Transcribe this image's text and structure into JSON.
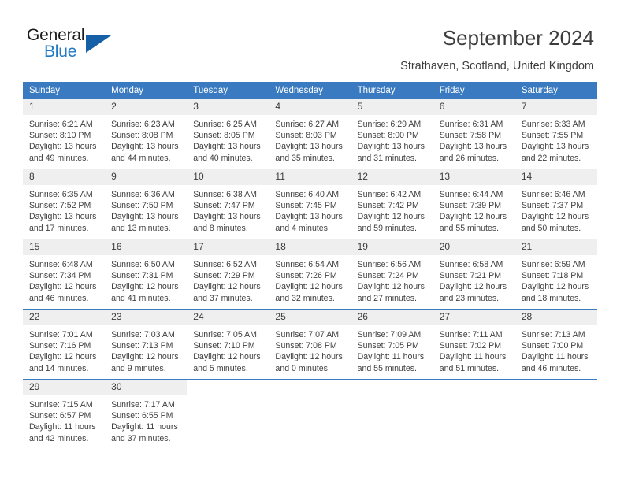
{
  "brand": {
    "name_top": "General",
    "name_bottom": "Blue",
    "triangle_color": "#1660a8",
    "blue_color": "#1f7ac4"
  },
  "header": {
    "title": "September 2024",
    "subtitle": "Strathaven, Scotland, United Kingdom"
  },
  "theme": {
    "header_blue": "#3a7ac0",
    "daynum_band": "#efefef",
    "text": "#3a3a3a"
  },
  "calendar": {
    "weekday_headers": [
      "Sunday",
      "Monday",
      "Tuesday",
      "Wednesday",
      "Thursday",
      "Friday",
      "Saturday"
    ],
    "weeks": [
      [
        {
          "day": "1",
          "sunrise": "Sunrise: 6:21 AM",
          "sunset": "Sunset: 8:10 PM",
          "daylight1": "Daylight: 13 hours",
          "daylight2": "and 49 minutes."
        },
        {
          "day": "2",
          "sunrise": "Sunrise: 6:23 AM",
          "sunset": "Sunset: 8:08 PM",
          "daylight1": "Daylight: 13 hours",
          "daylight2": "and 44 minutes."
        },
        {
          "day": "3",
          "sunrise": "Sunrise: 6:25 AM",
          "sunset": "Sunset: 8:05 PM",
          "daylight1": "Daylight: 13 hours",
          "daylight2": "and 40 minutes."
        },
        {
          "day": "4",
          "sunrise": "Sunrise: 6:27 AM",
          "sunset": "Sunset: 8:03 PM",
          "daylight1": "Daylight: 13 hours",
          "daylight2": "and 35 minutes."
        },
        {
          "day": "5",
          "sunrise": "Sunrise: 6:29 AM",
          "sunset": "Sunset: 8:00 PM",
          "daylight1": "Daylight: 13 hours",
          "daylight2": "and 31 minutes."
        },
        {
          "day": "6",
          "sunrise": "Sunrise: 6:31 AM",
          "sunset": "Sunset: 7:58 PM",
          "daylight1": "Daylight: 13 hours",
          "daylight2": "and 26 minutes."
        },
        {
          "day": "7",
          "sunrise": "Sunrise: 6:33 AM",
          "sunset": "Sunset: 7:55 PM",
          "daylight1": "Daylight: 13 hours",
          "daylight2": "and 22 minutes."
        }
      ],
      [
        {
          "day": "8",
          "sunrise": "Sunrise: 6:35 AM",
          "sunset": "Sunset: 7:52 PM",
          "daylight1": "Daylight: 13 hours",
          "daylight2": "and 17 minutes."
        },
        {
          "day": "9",
          "sunrise": "Sunrise: 6:36 AM",
          "sunset": "Sunset: 7:50 PM",
          "daylight1": "Daylight: 13 hours",
          "daylight2": "and 13 minutes."
        },
        {
          "day": "10",
          "sunrise": "Sunrise: 6:38 AM",
          "sunset": "Sunset: 7:47 PM",
          "daylight1": "Daylight: 13 hours",
          "daylight2": "and 8 minutes."
        },
        {
          "day": "11",
          "sunrise": "Sunrise: 6:40 AM",
          "sunset": "Sunset: 7:45 PM",
          "daylight1": "Daylight: 13 hours",
          "daylight2": "and 4 minutes."
        },
        {
          "day": "12",
          "sunrise": "Sunrise: 6:42 AM",
          "sunset": "Sunset: 7:42 PM",
          "daylight1": "Daylight: 12 hours",
          "daylight2": "and 59 minutes."
        },
        {
          "day": "13",
          "sunrise": "Sunrise: 6:44 AM",
          "sunset": "Sunset: 7:39 PM",
          "daylight1": "Daylight: 12 hours",
          "daylight2": "and 55 minutes."
        },
        {
          "day": "14",
          "sunrise": "Sunrise: 6:46 AM",
          "sunset": "Sunset: 7:37 PM",
          "daylight1": "Daylight: 12 hours",
          "daylight2": "and 50 minutes."
        }
      ],
      [
        {
          "day": "15",
          "sunrise": "Sunrise: 6:48 AM",
          "sunset": "Sunset: 7:34 PM",
          "daylight1": "Daylight: 12 hours",
          "daylight2": "and 46 minutes."
        },
        {
          "day": "16",
          "sunrise": "Sunrise: 6:50 AM",
          "sunset": "Sunset: 7:31 PM",
          "daylight1": "Daylight: 12 hours",
          "daylight2": "and 41 minutes."
        },
        {
          "day": "17",
          "sunrise": "Sunrise: 6:52 AM",
          "sunset": "Sunset: 7:29 PM",
          "daylight1": "Daylight: 12 hours",
          "daylight2": "and 37 minutes."
        },
        {
          "day": "18",
          "sunrise": "Sunrise: 6:54 AM",
          "sunset": "Sunset: 7:26 PM",
          "daylight1": "Daylight: 12 hours",
          "daylight2": "and 32 minutes."
        },
        {
          "day": "19",
          "sunrise": "Sunrise: 6:56 AM",
          "sunset": "Sunset: 7:24 PM",
          "daylight1": "Daylight: 12 hours",
          "daylight2": "and 27 minutes."
        },
        {
          "day": "20",
          "sunrise": "Sunrise: 6:58 AM",
          "sunset": "Sunset: 7:21 PM",
          "daylight1": "Daylight: 12 hours",
          "daylight2": "and 23 minutes."
        },
        {
          "day": "21",
          "sunrise": "Sunrise: 6:59 AM",
          "sunset": "Sunset: 7:18 PM",
          "daylight1": "Daylight: 12 hours",
          "daylight2": "and 18 minutes."
        }
      ],
      [
        {
          "day": "22",
          "sunrise": "Sunrise: 7:01 AM",
          "sunset": "Sunset: 7:16 PM",
          "daylight1": "Daylight: 12 hours",
          "daylight2": "and 14 minutes."
        },
        {
          "day": "23",
          "sunrise": "Sunrise: 7:03 AM",
          "sunset": "Sunset: 7:13 PM",
          "daylight1": "Daylight: 12 hours",
          "daylight2": "and 9 minutes."
        },
        {
          "day": "24",
          "sunrise": "Sunrise: 7:05 AM",
          "sunset": "Sunset: 7:10 PM",
          "daylight1": "Daylight: 12 hours",
          "daylight2": "and 5 minutes."
        },
        {
          "day": "25",
          "sunrise": "Sunrise: 7:07 AM",
          "sunset": "Sunset: 7:08 PM",
          "daylight1": "Daylight: 12 hours",
          "daylight2": "and 0 minutes."
        },
        {
          "day": "26",
          "sunrise": "Sunrise: 7:09 AM",
          "sunset": "Sunset: 7:05 PM",
          "daylight1": "Daylight: 11 hours",
          "daylight2": "and 55 minutes."
        },
        {
          "day": "27",
          "sunrise": "Sunrise: 7:11 AM",
          "sunset": "Sunset: 7:02 PM",
          "daylight1": "Daylight: 11 hours",
          "daylight2": "and 51 minutes."
        },
        {
          "day": "28",
          "sunrise": "Sunrise: 7:13 AM",
          "sunset": "Sunset: 7:00 PM",
          "daylight1": "Daylight: 11 hours",
          "daylight2": "and 46 minutes."
        }
      ],
      [
        {
          "day": "29",
          "sunrise": "Sunrise: 7:15 AM",
          "sunset": "Sunset: 6:57 PM",
          "daylight1": "Daylight: 11 hours",
          "daylight2": "and 42 minutes."
        },
        {
          "day": "30",
          "sunrise": "Sunrise: 7:17 AM",
          "sunset": "Sunset: 6:55 PM",
          "daylight1": "Daylight: 11 hours",
          "daylight2": "and 37 minutes."
        },
        {
          "day": "",
          "sunrise": "",
          "sunset": "",
          "daylight1": "",
          "daylight2": ""
        },
        {
          "day": "",
          "sunrise": "",
          "sunset": "",
          "daylight1": "",
          "daylight2": ""
        },
        {
          "day": "",
          "sunrise": "",
          "sunset": "",
          "daylight1": "",
          "daylight2": ""
        },
        {
          "day": "",
          "sunrise": "",
          "sunset": "",
          "daylight1": "",
          "daylight2": ""
        },
        {
          "day": "",
          "sunrise": "",
          "sunset": "",
          "daylight1": "",
          "daylight2": ""
        }
      ]
    ]
  }
}
